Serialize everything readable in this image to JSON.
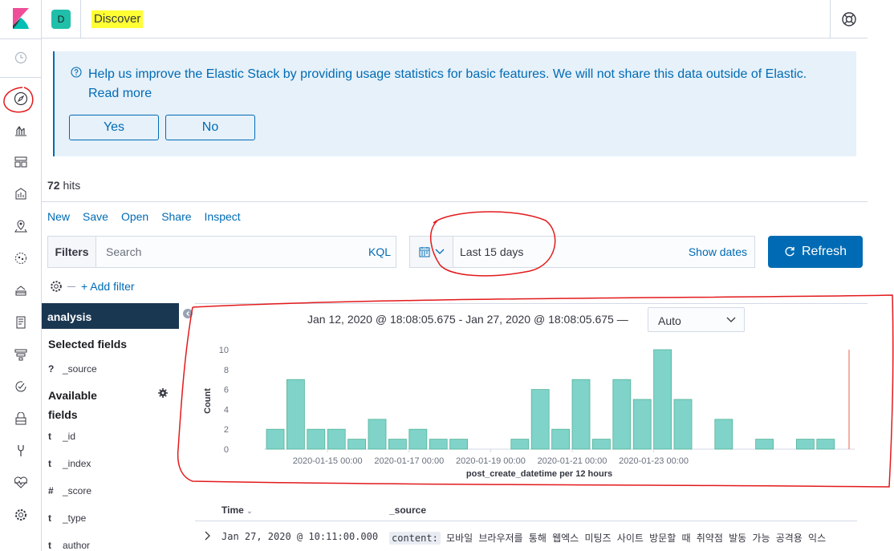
{
  "header": {
    "space_initial": "D",
    "breadcrumb": "Discover"
  },
  "callout": {
    "text": "Help us improve the Elastic Stack by providing usage statistics for basic features. We will not share this data outside of Elastic.",
    "link": "Read more",
    "yes_label": "Yes",
    "no_label": "No"
  },
  "hits": {
    "count": "72",
    "label": "hits"
  },
  "top_menu": [
    "New",
    "Save",
    "Open",
    "Share",
    "Inspect"
  ],
  "query": {
    "filters_label": "Filters",
    "search_placeholder": "Search",
    "language": "KQL"
  },
  "date_picker": {
    "range": "Last 15 days",
    "show_dates": "Show dates"
  },
  "refresh_label": "Refresh",
  "add_filter": "+ Add filter",
  "sidebar": {
    "index_pattern": "analysis",
    "selected_title": "Selected fields",
    "selected_fields": [
      {
        "type": "?",
        "name": "_source"
      }
    ],
    "available_title_line1": "Available",
    "available_title_line2": "fields",
    "available_fields": [
      {
        "type": "t",
        "name": "_id"
      },
      {
        "type": "t",
        "name": "_index"
      },
      {
        "type": "#",
        "name": "_score"
      },
      {
        "type": "t",
        "name": "_type"
      },
      {
        "type": "t",
        "name": "author"
      }
    ]
  },
  "histogram": {
    "date_range": "Jan 12, 2020 @ 18:08:05.675 - Jan 27, 2020 @ 18:08:05.675 —",
    "interval": "Auto"
  },
  "chart_data": {
    "type": "bar",
    "xlabel": "post_create_datetime per 12 hours",
    "ylabel": "Count",
    "ylim": [
      0,
      10
    ],
    "yticks": [
      0,
      2,
      4,
      6,
      8,
      10
    ],
    "x_tick_labels": [
      "2020-01-15 00:00",
      "2020-01-17 00:00",
      "2020-01-19 00:00",
      "2020-01-21 00:00",
      "2020-01-23 00:00"
    ],
    "categories": [
      "2020-01-13 12:00",
      "2020-01-14 00:00",
      "2020-01-14 12:00",
      "2020-01-15 00:00",
      "2020-01-15 12:00",
      "2020-01-16 00:00",
      "2020-01-16 12:00",
      "2020-01-17 00:00",
      "2020-01-17 12:00",
      "2020-01-18 00:00",
      "2020-01-18 12:00",
      "2020-01-19 00:00",
      "2020-01-19 12:00",
      "2020-01-20 00:00",
      "2020-01-20 12:00",
      "2020-01-21 00:00",
      "2020-01-21 12:00",
      "2020-01-22 00:00",
      "2020-01-22 12:00",
      "2020-01-23 00:00",
      "2020-01-23 12:00",
      "2020-01-24 00:00",
      "2020-01-24 12:00",
      "2020-01-25 00:00",
      "2020-01-25 12:00",
      "2020-01-26 00:00",
      "2020-01-26 12:00",
      "2020-01-27 00:00"
    ],
    "values": [
      2,
      7,
      2,
      2,
      1,
      3,
      1,
      2,
      1,
      1,
      0,
      0,
      1,
      6,
      2,
      7,
      1,
      7,
      5,
      10,
      5,
      0,
      3,
      0,
      1,
      0,
      1,
      1
    ],
    "bar_color": "#7fd3c9",
    "bar_stroke": "#54b399",
    "now_marker_color": "#e7664c"
  },
  "table": {
    "col_time": "Time",
    "col_source": "_source",
    "rows": [
      {
        "time": "Jan 27, 2020 @ 10:11:00.000",
        "source_key": "content:",
        "source_value": "모바일 브라우저를 통해 웹엑스 미팅즈 사이트 방문할 때 취약점 발동 가능 공격용 익스"
      }
    ]
  },
  "colors": {
    "accent": "#006bb4",
    "callout_bg": "#e6f1fa",
    "sidebar_header": "#1a3752",
    "highlight": "#ffff33",
    "annotation": "#e31a1c"
  }
}
